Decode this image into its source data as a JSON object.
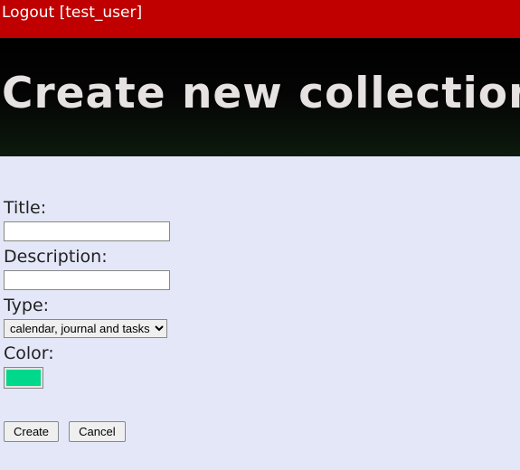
{
  "topbar": {
    "logout_label": "Logout",
    "user_suffix": "[test_user]"
  },
  "banner": {
    "title": "Create new collection"
  },
  "form": {
    "title_label": "Title:",
    "title_value": "",
    "description_label": "Description:",
    "description_value": "",
    "type_label": "Type:",
    "type_selected": "calendar, journal and tasks",
    "color_label": "Color:",
    "color_value": "#00d88c"
  },
  "buttons": {
    "create": "Create",
    "cancel": "Cancel"
  }
}
